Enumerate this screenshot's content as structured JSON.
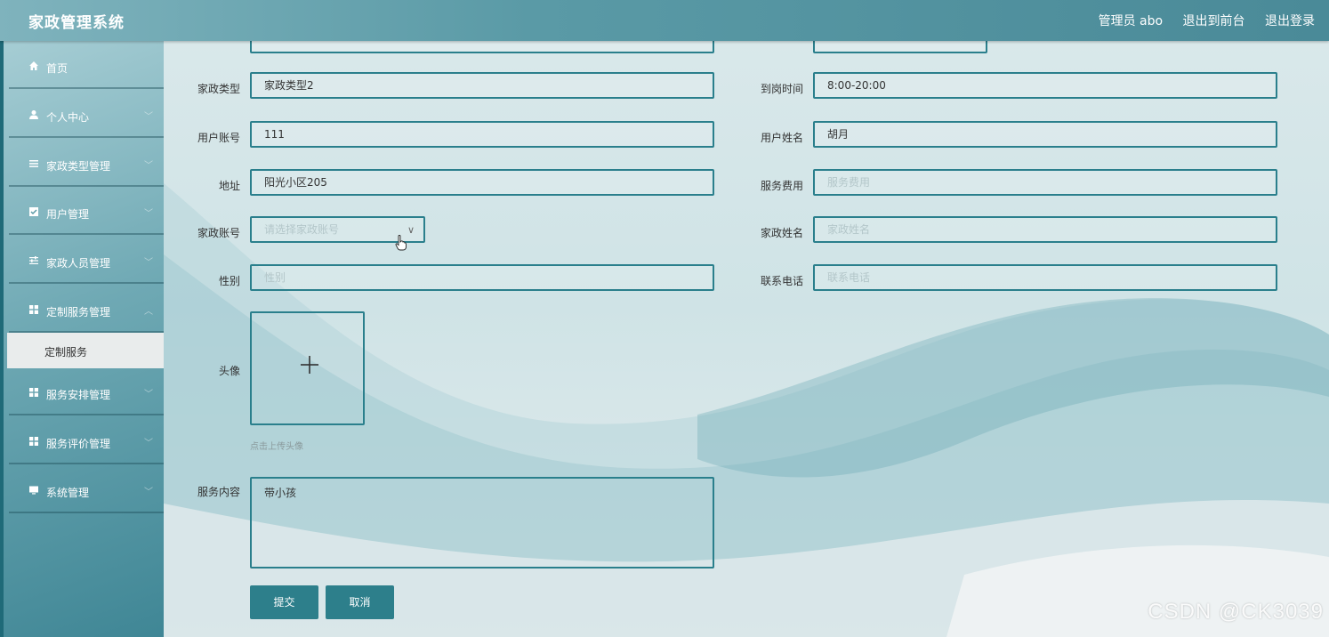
{
  "header": {
    "title": "家政管理系统",
    "admin": "管理员 abo",
    "to_front": "退出到前台",
    "logout": "退出登录"
  },
  "sidebar": {
    "items": [
      {
        "label": "首页",
        "icon": "home-icon"
      },
      {
        "label": "个人中心",
        "icon": "user-icon"
      },
      {
        "label": "家政类型管理",
        "icon": "list-icon"
      },
      {
        "label": "用户管理",
        "icon": "checkbox-icon"
      },
      {
        "label": "家政人员管理",
        "icon": "sliders-icon"
      },
      {
        "label": "定制服务管理",
        "icon": "grid-icon"
      },
      {
        "label": "服务安排管理",
        "icon": "grid-icon"
      },
      {
        "label": "服务评价管理",
        "icon": "grid-icon"
      },
      {
        "label": "系统管理",
        "icon": "monitor-icon"
      }
    ],
    "active_sub": "定制服务"
  },
  "form": {
    "type_label": "家政类型",
    "type_value": "家政类型2",
    "arrive_label": "到岗时间",
    "arrive_value": "8:00-20:00",
    "account_label": "用户账号",
    "account_value": "111",
    "username_label": "用户姓名",
    "username_value": "胡月",
    "address_label": "地址",
    "address_value": "阳光小区205",
    "fee_label": "服务费用",
    "fee_placeholder": "服务费用",
    "hk_account_label": "家政账号",
    "hk_account_placeholder": "请选择家政账号",
    "hk_name_label": "家政姓名",
    "hk_name_placeholder": "家政姓名",
    "gender_label": "性别",
    "gender_placeholder": "性别",
    "phone_label": "联系电话",
    "phone_placeholder": "联系电话",
    "avatar_label": "头像",
    "avatar_hint": "点击上传头像",
    "content_label": "服务内容",
    "content_value": "带小孩",
    "submit": "提交",
    "cancel": "取消"
  },
  "watermark": "CSDN @CK3039"
}
